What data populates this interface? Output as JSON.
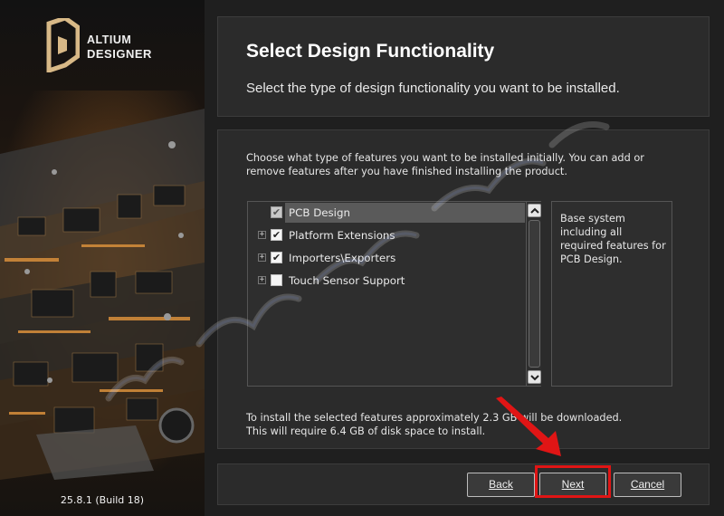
{
  "branding": {
    "logo_line1": "ALTIUM",
    "logo_line2": "DESIGNER",
    "version": "25.8.1 (Build 18)"
  },
  "header": {
    "title": "Select Design Functionality",
    "subtitle": "Select the type of design functionality you want to be installed."
  },
  "content": {
    "intro": "Choose what type of features you want to be installed initially. You can add or remove features after you have finished installing the product.",
    "features": [
      {
        "label": "PCB Design",
        "checked": true,
        "expandable": false,
        "selected": true
      },
      {
        "label": "Platform Extensions",
        "checked": true,
        "expandable": true,
        "selected": false
      },
      {
        "label": "Importers\\Exporters",
        "checked": true,
        "expandable": true,
        "selected": false
      },
      {
        "label": "Touch Sensor Support",
        "checked": false,
        "expandable": true,
        "selected": false
      }
    ],
    "description": "Base system including all required features for PCB Design.",
    "download_line1": "To install the selected features approximately 2.3 GB will be downloaded.",
    "download_line2": "This will require 6.4 GB of disk space to install."
  },
  "buttons": {
    "back": "Back",
    "next": "Next",
    "cancel": "Cancel"
  },
  "colors": {
    "background": "#1f1f1f",
    "panel": "#2b2b2b",
    "highlight": "#e01515",
    "selection": "#5a5a5a"
  }
}
